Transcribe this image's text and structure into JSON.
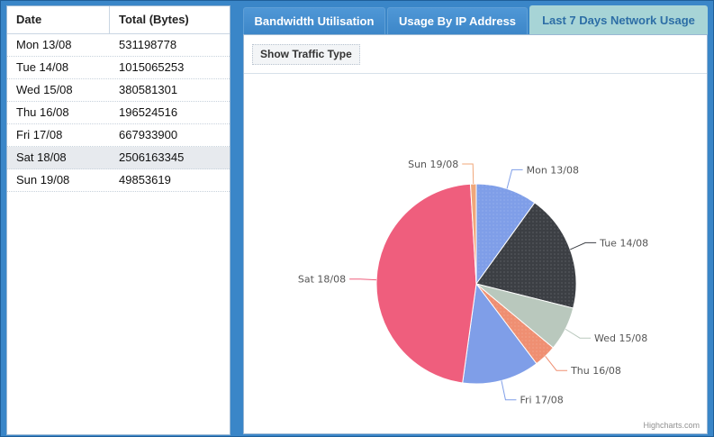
{
  "grid": {
    "headers": {
      "date": "Date",
      "total": "Total (Bytes)"
    },
    "rows": [
      {
        "date": "Mon 13/08",
        "total": "531198778"
      },
      {
        "date": "Tue 14/08",
        "total": "1015065253"
      },
      {
        "date": "Wed 15/08",
        "total": "380581301"
      },
      {
        "date": "Thu 16/08",
        "total": "196524516"
      },
      {
        "date": "Fri 17/08",
        "total": "667933900"
      },
      {
        "date": "Sat 18/08",
        "total": "2506163345"
      },
      {
        "date": "Sun 19/08",
        "total": "49853619"
      }
    ],
    "selected_index": 5
  },
  "tabs": [
    {
      "label": "Bandwidth Utilisation",
      "active": false
    },
    {
      "label": "Usage By IP Address",
      "active": false
    },
    {
      "label": "Last 7 Days Network Usage",
      "active": true
    }
  ],
  "toolbar": {
    "show_traffic_label": "Show Traffic Type"
  },
  "credits": "Highcharts.com",
  "chart_data": {
    "type": "pie",
    "categories": [
      "Mon 13/08",
      "Tue 14/08",
      "Wed 15/08",
      "Thu 16/08",
      "Fri 17/08",
      "Sat 18/08",
      "Sun 19/08"
    ],
    "values": [
      531198778,
      1015065253,
      380581301,
      196524516,
      667933900,
      2506163345,
      49853619
    ],
    "colors": [
      "#7f9ee8",
      "#3c3f44",
      "#b9c8bd",
      "#ef8f72",
      "#7f9ee8",
      "#ef5e7d",
      "#f0a77a"
    ],
    "title": ""
  }
}
